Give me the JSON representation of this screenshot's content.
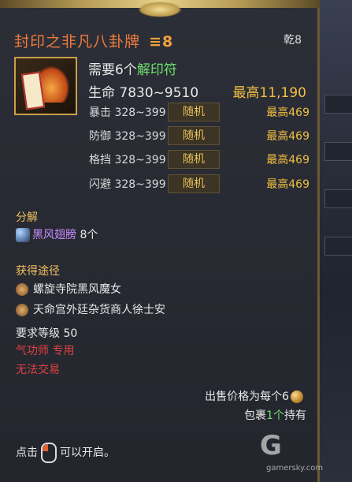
{
  "item": {
    "name": "封印之非凡八卦牌",
    "grade_icon": "≡",
    "grade_number": "8",
    "slot": "乾8",
    "icon": "bagua-card-icon"
  },
  "requirement": {
    "prefix": "需要6个",
    "material": "解印符"
  },
  "hp": {
    "range": "生命 7830~9510",
    "max": "最高11,190"
  },
  "stats": [
    {
      "label": "暴击 328~399",
      "button": "随机",
      "max": "最高469"
    },
    {
      "label": "防御 328~399",
      "button": "随机",
      "max": "最高469"
    },
    {
      "label": "格挡 328~399",
      "button": "随机",
      "max": "最高469"
    },
    {
      "label": "闪避 328~399",
      "button": "随机",
      "max": "最高469"
    }
  ],
  "decompose": {
    "title": "分解",
    "material": "黑风翅膀",
    "count": "8个"
  },
  "sources": {
    "title": "获得途径",
    "items": [
      "螺旋寺院黑风魔女",
      "天命宫外廷杂货商人徐士安"
    ]
  },
  "level_req": "要求等级 50",
  "class_req": "气功师 专用",
  "trade": "无法交易",
  "sell": {
    "text": "出售价格为每个6"
  },
  "bag": {
    "prefix": "包裹",
    "count": "1个",
    "suffix": "持有"
  },
  "open_hint": {
    "prefix": "点击",
    "suffix": "可以开启。"
  },
  "watermark": {
    "logo": "G",
    "text": "gamersky.com"
  },
  "colors": {
    "title": "#f07a3c",
    "gold": "#f3c040",
    "green": "#6fe06f",
    "purple": "#c88cff",
    "red": "#e04040"
  }
}
